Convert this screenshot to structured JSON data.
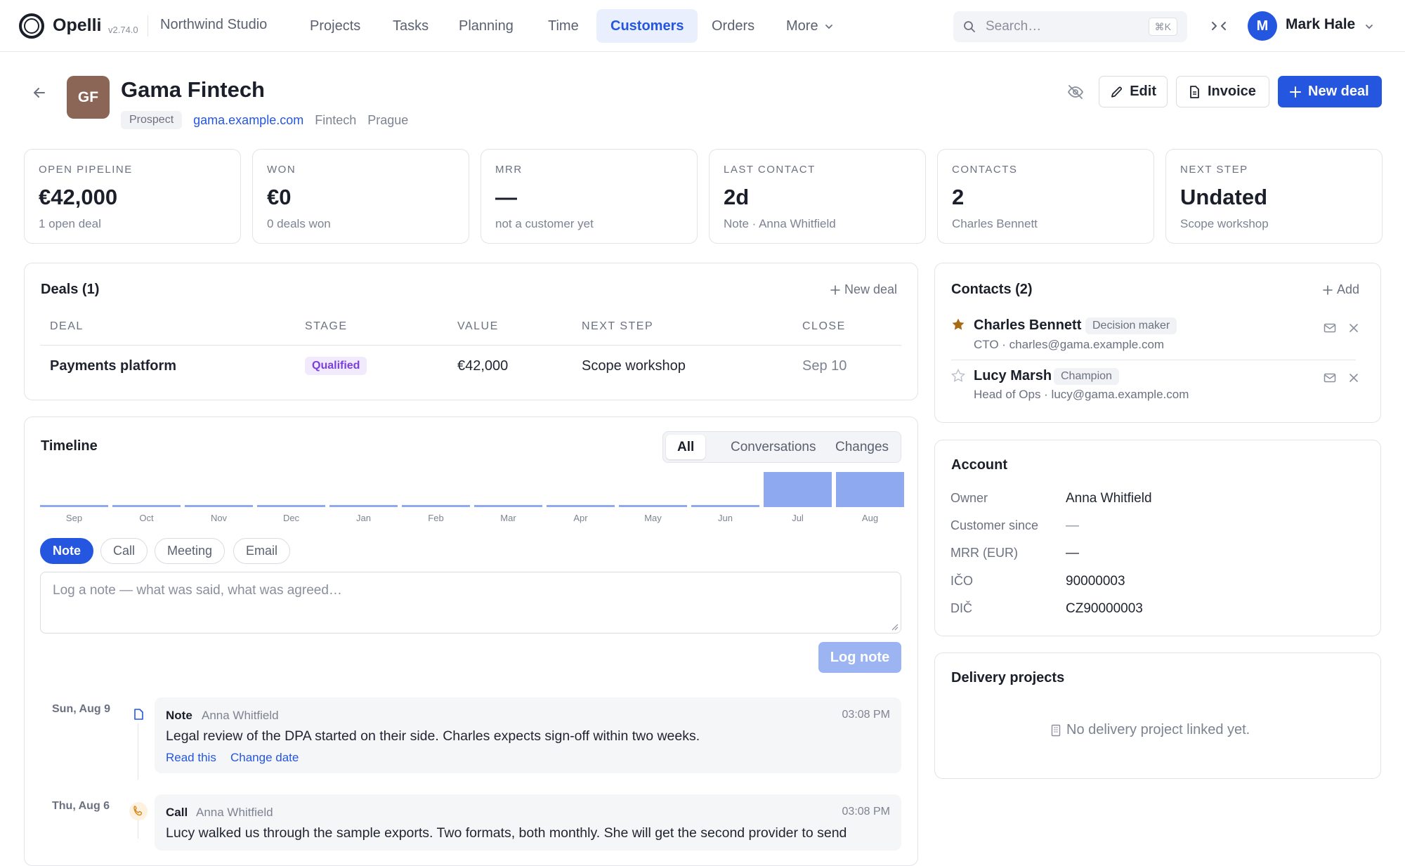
{
  "app": {
    "name": "Opelli",
    "version": "v2.74.0",
    "workspace": "Northwind Studio",
    "nav": [
      {
        "label": "Projects"
      },
      {
        "label": "Tasks"
      },
      {
        "label": "Planning"
      },
      {
        "label": "Time"
      },
      {
        "label": "Customers"
      },
      {
        "label": "Orders"
      },
      {
        "label": "More"
      }
    ],
    "active_nav": "Customers",
    "search": {
      "placeholder": "Search…",
      "shortcut": "⌘K"
    },
    "user": {
      "initial": "M",
      "name": "Mark Hale"
    },
    "accent": "#2456e0"
  },
  "customer": {
    "initials": "GF",
    "name": "Gama Fintech",
    "status": "Prospect",
    "website": "gama.example.com",
    "industry": "Fintech",
    "city": "Prague",
    "avatar_color": "#8b6656",
    "actions": {
      "edit": "Edit",
      "invoice": "Invoice",
      "new_deal": "New deal"
    }
  },
  "kpis": [
    {
      "label": "OPEN PIPELINE",
      "value": "€42,000",
      "sub": "1 open deal"
    },
    {
      "label": "WON",
      "value": "€0",
      "sub": "0 deals won"
    },
    {
      "label": "MRR",
      "value": "—",
      "sub": "not a customer yet"
    },
    {
      "label": "LAST CONTACT",
      "value": "2d",
      "sub": "Note · Anna Whitfield"
    },
    {
      "label": "CONTACTS",
      "value": "2",
      "sub": "Charles Bennett"
    },
    {
      "label": "NEXT STEP",
      "value": "Undated",
      "sub": "Scope workshop"
    }
  ],
  "deals": {
    "title": "Deals (1)",
    "action": "New deal",
    "columns": [
      "DEAL",
      "STAGE",
      "VALUE",
      "NEXT STEP",
      "CLOSE"
    ],
    "rows": [
      {
        "deal": "Payments platform",
        "stage": "Qualified",
        "value": "€42,000",
        "next_step": "Scope workshop",
        "close": "Sep 10"
      }
    ]
  },
  "timeline": {
    "title": "Timeline",
    "filters": [
      "All",
      "Conversations",
      "Changes"
    ],
    "active_filter": "All",
    "months": [
      "Sep",
      "Oct",
      "Nov",
      "Dec",
      "Jan",
      "Feb",
      "Mar",
      "Apr",
      "May",
      "Jun",
      "Jul",
      "Aug"
    ],
    "activity_level": [
      0,
      0,
      0,
      0,
      0,
      0,
      0,
      0,
      0,
      0,
      1,
      1
    ],
    "types": [
      "Note",
      "Call",
      "Meeting",
      "Email"
    ],
    "active_type": "Note",
    "note_placeholder": "Log a note — what was said, what was agreed…",
    "log_button": "Log note",
    "entries": [
      {
        "date": "Sun, Aug 9",
        "type": "Note",
        "author": "Anna Whitfield",
        "time": "03:08 PM",
        "body": "Legal review of the DPA started on their side. Charles expects sign-off within two weeks.",
        "links": [
          "Read this",
          "Change date"
        ],
        "icon": "note-icon"
      },
      {
        "date": "Thu, Aug 6",
        "type": "Call",
        "author": "Anna Whitfield",
        "time": "03:08 PM",
        "body": "Lucy walked us through the sample exports. Two formats, both monthly. She will get the second provider to send",
        "icon": "phone-icon"
      }
    ]
  },
  "contacts": {
    "title": "Contacts (2)",
    "action": "Add",
    "items": [
      {
        "name": "Charles Bennett",
        "role": "Decision maker",
        "sub": "CTO · charles@gama.example.com",
        "primary": true
      },
      {
        "name": "Lucy Marsh",
        "role": "Champion",
        "sub": "Head of Ops · lucy@gama.example.com",
        "primary": false
      }
    ]
  },
  "account": {
    "title": "Account",
    "rows": [
      {
        "key": "Owner",
        "value": "Anna Whitfield"
      },
      {
        "key": "Customer since",
        "value": "—"
      },
      {
        "key": "MRR (EUR)",
        "value": "—"
      },
      {
        "key": "IČO",
        "value": "90000003"
      },
      {
        "key": "DIČ",
        "value": "CZ90000003"
      }
    ]
  },
  "delivery": {
    "title": "Delivery projects",
    "empty": "No delivery project linked yet."
  }
}
